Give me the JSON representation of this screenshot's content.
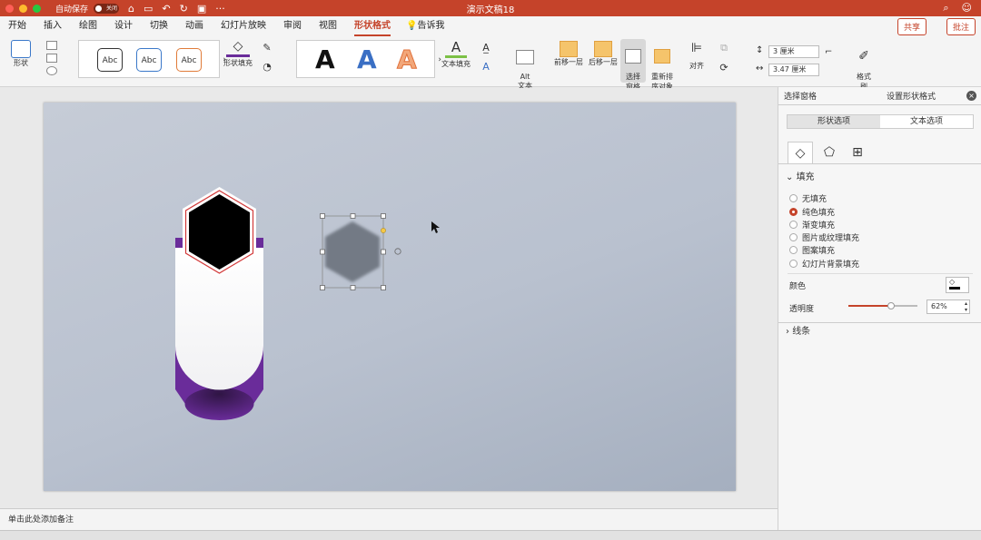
{
  "titlebar": {
    "autosave_label": "自动保存",
    "toggle_label": "关闭",
    "doc_title": "演示文稿18"
  },
  "menu": {
    "tabs": [
      "开始",
      "插入",
      "绘图",
      "设计",
      "切换",
      "动画",
      "幻灯片放映",
      "审阅",
      "视图",
      "形状格式"
    ],
    "tell_label": "告诉我",
    "share_label": "共享",
    "comment_label": "批注"
  },
  "ribbon": {
    "shape_label": "形状",
    "styles": [
      "Abc",
      "Abc",
      "Abc"
    ],
    "shape_fill_label": "形状填充",
    "wordart": [
      "A",
      "A",
      "A"
    ],
    "text_fill_label": "文本填充",
    "alt_text_label": "Alt\n文本",
    "bring_forward_label": "前移一层",
    "send_backward_label": "后移一层",
    "selection_pane_label": "选择\n窗格",
    "reorder_label": "重新排\n序对象",
    "align_label": "对齐",
    "height_value": "3 厘米",
    "width_value": "3.47 厘米",
    "format_painter_label": "格式\n刷"
  },
  "notes_placeholder": "单击此处添加备注",
  "panel": {
    "tab_selection": "选择窗格",
    "tab_format": "设置形状格式",
    "shape_options": "形状选项",
    "text_options": "文本选项",
    "fill_section": "填充",
    "fill_options": [
      "无填充",
      "纯色填充",
      "渐变填充",
      "图片或纹理填充",
      "图案填充",
      "幻灯片背景填充"
    ],
    "selected_fill": 1,
    "color_label": "颜色",
    "transparency_label": "透明度",
    "transparency_value": "62%",
    "transparency_fraction": 0.62,
    "line_section": "线条"
  },
  "colors": {
    "accent": "#c5432a",
    "purple": "#6a2c9a"
  }
}
